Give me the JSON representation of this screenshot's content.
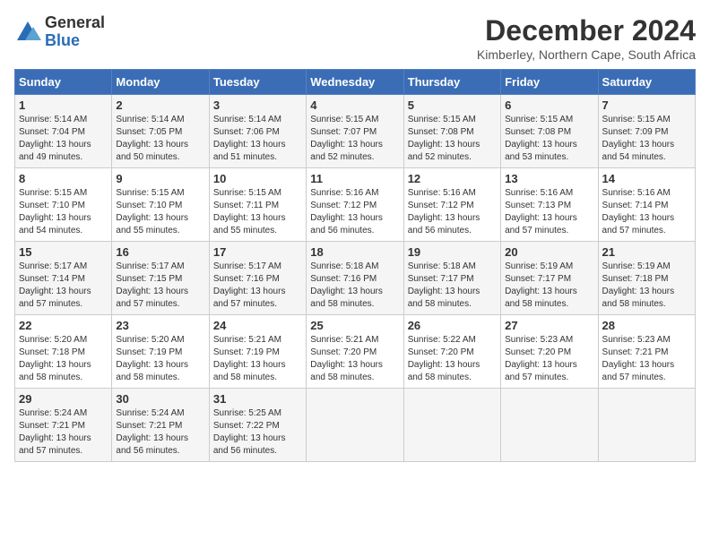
{
  "logo": {
    "general": "General",
    "blue": "Blue"
  },
  "title": "December 2024",
  "subtitle": "Kimberley, Northern Cape, South Africa",
  "days_header": [
    "Sunday",
    "Monday",
    "Tuesday",
    "Wednesday",
    "Thursday",
    "Friday",
    "Saturday"
  ],
  "weeks": [
    [
      {
        "day": "1",
        "sunrise": "Sunrise: 5:14 AM",
        "sunset": "Sunset: 7:04 PM",
        "daylight": "Daylight: 13 hours and 49 minutes."
      },
      {
        "day": "2",
        "sunrise": "Sunrise: 5:14 AM",
        "sunset": "Sunset: 7:05 PM",
        "daylight": "Daylight: 13 hours and 50 minutes."
      },
      {
        "day": "3",
        "sunrise": "Sunrise: 5:14 AM",
        "sunset": "Sunset: 7:06 PM",
        "daylight": "Daylight: 13 hours and 51 minutes."
      },
      {
        "day": "4",
        "sunrise": "Sunrise: 5:15 AM",
        "sunset": "Sunset: 7:07 PM",
        "daylight": "Daylight: 13 hours and 52 minutes."
      },
      {
        "day": "5",
        "sunrise": "Sunrise: 5:15 AM",
        "sunset": "Sunset: 7:08 PM",
        "daylight": "Daylight: 13 hours and 52 minutes."
      },
      {
        "day": "6",
        "sunrise": "Sunrise: 5:15 AM",
        "sunset": "Sunset: 7:08 PM",
        "daylight": "Daylight: 13 hours and 53 minutes."
      },
      {
        "day": "7",
        "sunrise": "Sunrise: 5:15 AM",
        "sunset": "Sunset: 7:09 PM",
        "daylight": "Daylight: 13 hours and 54 minutes."
      }
    ],
    [
      {
        "day": "8",
        "sunrise": "Sunrise: 5:15 AM",
        "sunset": "Sunset: 7:10 PM",
        "daylight": "Daylight: 13 hours and 54 minutes."
      },
      {
        "day": "9",
        "sunrise": "Sunrise: 5:15 AM",
        "sunset": "Sunset: 7:10 PM",
        "daylight": "Daylight: 13 hours and 55 minutes."
      },
      {
        "day": "10",
        "sunrise": "Sunrise: 5:15 AM",
        "sunset": "Sunset: 7:11 PM",
        "daylight": "Daylight: 13 hours and 55 minutes."
      },
      {
        "day": "11",
        "sunrise": "Sunrise: 5:16 AM",
        "sunset": "Sunset: 7:12 PM",
        "daylight": "Daylight: 13 hours and 56 minutes."
      },
      {
        "day": "12",
        "sunrise": "Sunrise: 5:16 AM",
        "sunset": "Sunset: 7:12 PM",
        "daylight": "Daylight: 13 hours and 56 minutes."
      },
      {
        "day": "13",
        "sunrise": "Sunrise: 5:16 AM",
        "sunset": "Sunset: 7:13 PM",
        "daylight": "Daylight: 13 hours and 57 minutes."
      },
      {
        "day": "14",
        "sunrise": "Sunrise: 5:16 AM",
        "sunset": "Sunset: 7:14 PM",
        "daylight": "Daylight: 13 hours and 57 minutes."
      }
    ],
    [
      {
        "day": "15",
        "sunrise": "Sunrise: 5:17 AM",
        "sunset": "Sunset: 7:14 PM",
        "daylight": "Daylight: 13 hours and 57 minutes."
      },
      {
        "day": "16",
        "sunrise": "Sunrise: 5:17 AM",
        "sunset": "Sunset: 7:15 PM",
        "daylight": "Daylight: 13 hours and 57 minutes."
      },
      {
        "day": "17",
        "sunrise": "Sunrise: 5:17 AM",
        "sunset": "Sunset: 7:16 PM",
        "daylight": "Daylight: 13 hours and 57 minutes."
      },
      {
        "day": "18",
        "sunrise": "Sunrise: 5:18 AM",
        "sunset": "Sunset: 7:16 PM",
        "daylight": "Daylight: 13 hours and 58 minutes."
      },
      {
        "day": "19",
        "sunrise": "Sunrise: 5:18 AM",
        "sunset": "Sunset: 7:17 PM",
        "daylight": "Daylight: 13 hours and 58 minutes."
      },
      {
        "day": "20",
        "sunrise": "Sunrise: 5:19 AM",
        "sunset": "Sunset: 7:17 PM",
        "daylight": "Daylight: 13 hours and 58 minutes."
      },
      {
        "day": "21",
        "sunrise": "Sunrise: 5:19 AM",
        "sunset": "Sunset: 7:18 PM",
        "daylight": "Daylight: 13 hours and 58 minutes."
      }
    ],
    [
      {
        "day": "22",
        "sunrise": "Sunrise: 5:20 AM",
        "sunset": "Sunset: 7:18 PM",
        "daylight": "Daylight: 13 hours and 58 minutes."
      },
      {
        "day": "23",
        "sunrise": "Sunrise: 5:20 AM",
        "sunset": "Sunset: 7:19 PM",
        "daylight": "Daylight: 13 hours and 58 minutes."
      },
      {
        "day": "24",
        "sunrise": "Sunrise: 5:21 AM",
        "sunset": "Sunset: 7:19 PM",
        "daylight": "Daylight: 13 hours and 58 minutes."
      },
      {
        "day": "25",
        "sunrise": "Sunrise: 5:21 AM",
        "sunset": "Sunset: 7:20 PM",
        "daylight": "Daylight: 13 hours and 58 minutes."
      },
      {
        "day": "26",
        "sunrise": "Sunrise: 5:22 AM",
        "sunset": "Sunset: 7:20 PM",
        "daylight": "Daylight: 13 hours and 58 minutes."
      },
      {
        "day": "27",
        "sunrise": "Sunrise: 5:23 AM",
        "sunset": "Sunset: 7:20 PM",
        "daylight": "Daylight: 13 hours and 57 minutes."
      },
      {
        "day": "28",
        "sunrise": "Sunrise: 5:23 AM",
        "sunset": "Sunset: 7:21 PM",
        "daylight": "Daylight: 13 hours and 57 minutes."
      }
    ],
    [
      {
        "day": "29",
        "sunrise": "Sunrise: 5:24 AM",
        "sunset": "Sunset: 7:21 PM",
        "daylight": "Daylight: 13 hours and 57 minutes."
      },
      {
        "day": "30",
        "sunrise": "Sunrise: 5:24 AM",
        "sunset": "Sunset: 7:21 PM",
        "daylight": "Daylight: 13 hours and 56 minutes."
      },
      {
        "day": "31",
        "sunrise": "Sunrise: 5:25 AM",
        "sunset": "Sunset: 7:22 PM",
        "daylight": "Daylight: 13 hours and 56 minutes."
      },
      null,
      null,
      null,
      null
    ]
  ]
}
